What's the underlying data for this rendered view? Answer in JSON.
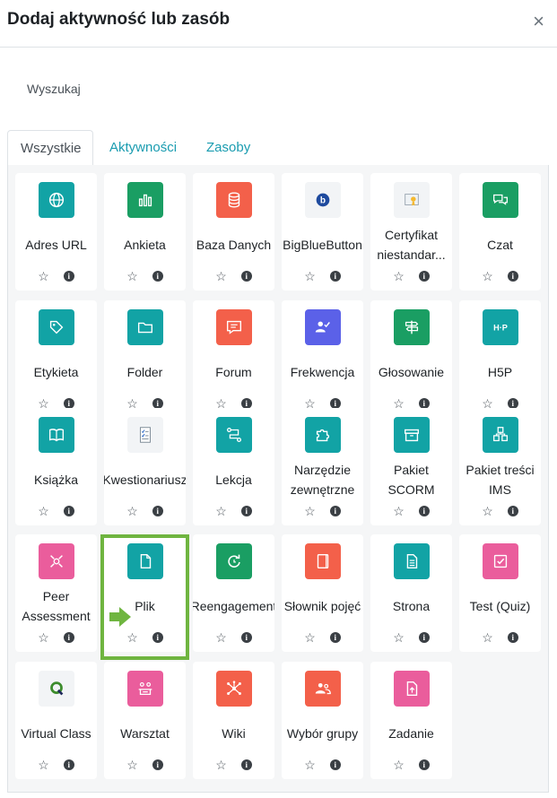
{
  "modal": {
    "title": "Dodaj aktywność lub zasób",
    "close_symbol": "×",
    "search_label": "Wyszukaj"
  },
  "tabs": [
    {
      "label": "Wszystkie"
    },
    {
      "label": "Aktywności"
    },
    {
      "label": "Zasoby"
    }
  ],
  "star_symbol": "☆",
  "info_symbol": "i",
  "activities": [
    {
      "name": "Adres URL",
      "icon": "globe-icon",
      "color": "#12a3a5"
    },
    {
      "name": "Ankieta",
      "icon": "bar-chart-icon",
      "color": "#1a9e63"
    },
    {
      "name": "Baza Danych",
      "icon": "database-icon",
      "color": "#f3604a"
    },
    {
      "name": "BigBlueButton",
      "icon": "bigbluebutton-icon",
      "color": "#f2f4f6"
    },
    {
      "name": "Certyfikat niestandar...",
      "icon": "certificate-icon",
      "color": "#f2f4f6"
    },
    {
      "name": "Czat",
      "icon": "chat-icon",
      "color": "#1a9e63"
    },
    {
      "name": "Etykieta",
      "icon": "tag-icon",
      "color": "#12a3a5"
    },
    {
      "name": "Folder",
      "icon": "folder-icon",
      "color": "#12a3a5"
    },
    {
      "name": "Forum",
      "icon": "forum-icon",
      "color": "#f3604a"
    },
    {
      "name": "Frekwencja",
      "icon": "attendance-icon",
      "color": "#5b61e8"
    },
    {
      "name": "Głosowanie",
      "icon": "signpost-icon",
      "color": "#1a9e63"
    },
    {
      "name": "H5P",
      "icon": "h5p-icon",
      "color": "#12a3a5"
    },
    {
      "name": "Książka",
      "icon": "book-icon",
      "color": "#12a3a5"
    },
    {
      "name": "Kwestionariusz",
      "icon": "questionnaire-icon",
      "color": "#f2f4f6"
    },
    {
      "name": "Lekcja",
      "icon": "lesson-icon",
      "color": "#12a3a5"
    },
    {
      "name": "Narzędzie zewnętrzne",
      "icon": "puzzle-icon",
      "color": "#12a3a5"
    },
    {
      "name": "Pakiet SCORM",
      "icon": "package-icon",
      "color": "#12a3a5"
    },
    {
      "name": "Pakiet treści IMS",
      "icon": "ims-icon",
      "color": "#12a3a5"
    },
    {
      "name": "Peer Assessment",
      "icon": "peer-assessment-icon",
      "color": "#ea5d9c"
    },
    {
      "name": "Plik",
      "icon": "file-icon",
      "color": "#12a3a5"
    },
    {
      "name": "Reengagement",
      "icon": "reengagement-icon",
      "color": "#1a9e63"
    },
    {
      "name": "Słownik pojęć",
      "icon": "glossary-icon",
      "color": "#f3604a"
    },
    {
      "name": "Strona",
      "icon": "page-icon",
      "color": "#12a3a5"
    },
    {
      "name": "Test (Quiz)",
      "icon": "quiz-icon",
      "color": "#ea5d9c"
    },
    {
      "name": "Virtual Class",
      "icon": "virtual-class-icon",
      "color": "#f2f4f6"
    },
    {
      "name": "Warsztat",
      "icon": "workshop-icon",
      "color": "#ea5d9c"
    },
    {
      "name": "Wiki",
      "icon": "wiki-icon",
      "color": "#f3604a"
    },
    {
      "name": "Wybór grupy",
      "icon": "group-choice-icon",
      "color": "#f3604a"
    },
    {
      "name": "Zadanie",
      "icon": "assignment-icon",
      "color": "#ea5d9c"
    }
  ]
}
